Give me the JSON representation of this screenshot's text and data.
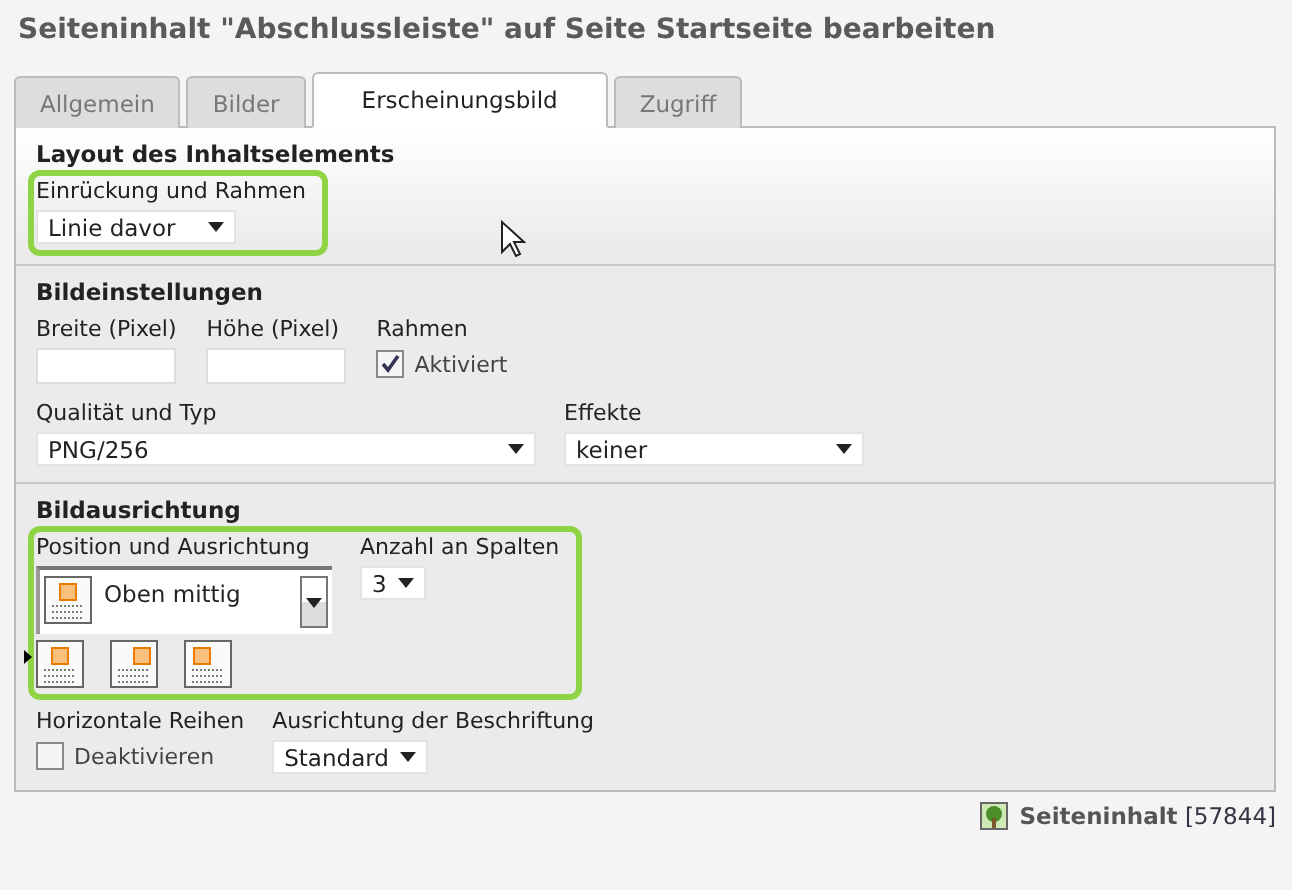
{
  "title": "Seiteninhalt \"Abschlussleiste\" auf Seite Startseite bearbeiten",
  "tabs": [
    {
      "label": "Allgemein",
      "selected": false
    },
    {
      "label": "Bilder",
      "selected": false
    },
    {
      "label": "Erscheinungsbild",
      "selected": true
    },
    {
      "label": "Zugriff",
      "selected": false
    }
  ],
  "sections": [
    {
      "heading": "Layout des Inhaltselements",
      "rows": [
        {
          "highlighted": true,
          "fields": [
            {
              "kind": "select",
              "label": "Einrückung und Rahmen",
              "value": "Linie davor"
            }
          ]
        }
      ]
    },
    {
      "heading": "Bildeinstellungen",
      "rows": [
        {
          "highlighted": false,
          "fields": [
            {
              "kind": "text",
              "label": "Breite (Pixel)"
            },
            {
              "kind": "text",
              "label": "Höhe (Pixel)"
            },
            {
              "kind": "checkbox",
              "label": "Rahmen",
              "option": "Aktiviert",
              "checked": true
            }
          ]
        },
        {
          "highlighted": false,
          "fields": [
            {
              "kind": "select",
              "label": "Qualität und Typ",
              "value": "PNG/256"
            },
            {
              "kind": "select",
              "label": "Effekte",
              "value": "keiner"
            }
          ]
        }
      ]
    },
    {
      "heading": "Bildausrichtung",
      "rows": [
        {
          "highlighted": true,
          "fields": [
            {
              "kind": "iconselect",
              "label": "Position und Ausrichtung",
              "value": "Oben mittig",
              "options": [
                {
                  "selected": true
                },
                {
                  "selected": false
                },
                {
                  "selected": false
                }
              ]
            },
            {
              "kind": "select",
              "label": "Anzahl an Spalten",
              "value": "3"
            }
          ]
        },
        {
          "highlighted": false,
          "fields": [
            {
              "kind": "checkbox",
              "label": "Horizontale Reihen",
              "option": "Deaktivieren",
              "checked": false
            },
            {
              "kind": "select",
              "label": "Ausrichtung der Beschriftung",
              "value": "Standard"
            }
          ]
        }
      ]
    }
  ],
  "footer": {
    "label": "Seiteninhalt",
    "id": "[57844]"
  }
}
